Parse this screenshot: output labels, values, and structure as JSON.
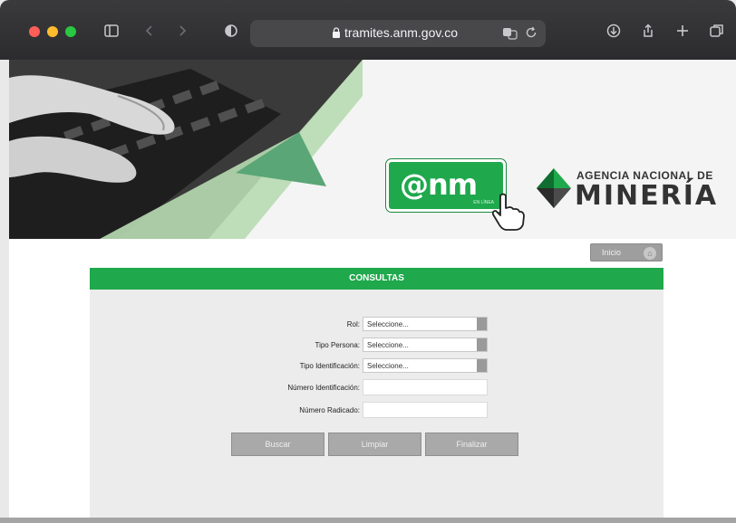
{
  "browser": {
    "url": "tramites.anm.gov.co",
    "icons": [
      "sidebar-icon",
      "back-icon",
      "forward-icon",
      "privacy-icon",
      "lock-icon",
      "translate-icon",
      "reload-icon",
      "download-icon",
      "share-icon",
      "new-tab-icon",
      "tabs-overview-icon"
    ]
  },
  "banner": {
    "logo_text": "@nm",
    "logo_sub": "EN LÍNEA",
    "agency_line1": "AGENCIA NACIONAL DE",
    "agency_line2": "MINERÍA"
  },
  "nav": {
    "inicio_label": "Inicio"
  },
  "form": {
    "title": "CONSULTAS",
    "fields": [
      {
        "label": "Rol:",
        "type": "select",
        "value": "Seleccione..."
      },
      {
        "label": "Tipo Persona:",
        "type": "select",
        "value": "Seleccione..."
      },
      {
        "label": "Tipo Identificación:",
        "type": "select",
        "value": "Seleccione..."
      },
      {
        "label": "Número Identificación:",
        "type": "text",
        "value": ""
      },
      {
        "label": "Número Radicado:",
        "type": "text",
        "value": ""
      }
    ],
    "buttons": {
      "search": "Buscar",
      "clear": "Limpiar",
      "finish": "Finalizar"
    }
  },
  "colors": {
    "brand_green": "#1fa84c",
    "chrome_dark": "#2c2c2e",
    "button_gray": "#a9a9a9"
  }
}
